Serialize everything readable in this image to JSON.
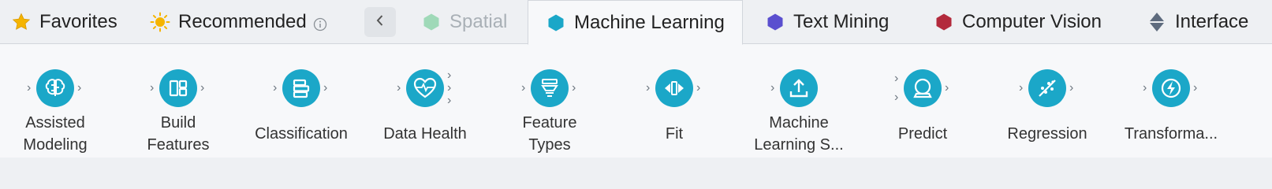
{
  "tabs": [
    {
      "label": "Favorites",
      "icon": "star-icon"
    },
    {
      "label": "Recommended",
      "icon": "sun-icon"
    },
    {
      "label": "Spatial",
      "icon": "hexagon-icon"
    },
    {
      "label": "Machine Learning",
      "icon": "hexagon-icon"
    },
    {
      "label": "Text Mining",
      "icon": "hexagon-icon"
    },
    {
      "label": "Computer Vision",
      "icon": "hexagon-icon"
    },
    {
      "label": "Interface",
      "icon": "diamond-icon"
    }
  ],
  "tools": [
    {
      "label": "Assisted\nModeling",
      "icon": "brain-icon"
    },
    {
      "label": "Build\nFeatures",
      "icon": "build-features-icon"
    },
    {
      "label": "Classification",
      "icon": "classification-icon"
    },
    {
      "label": "Data Health",
      "icon": "heart-pulse-icon"
    },
    {
      "label": "Feature\nTypes",
      "icon": "feature-types-icon"
    },
    {
      "label": "Fit",
      "icon": "fit-icon"
    },
    {
      "label": "Machine\nLearning S...",
      "icon": "upload-icon"
    },
    {
      "label": "Predict",
      "icon": "crystal-ball-icon"
    },
    {
      "label": "Regression",
      "icon": "regression-icon"
    },
    {
      "label": "Transforma...",
      "icon": "lightning-icon"
    }
  ],
  "colors": {
    "accent": "#1ba7c8",
    "spatial": "#9fd9b8",
    "text_mining": "#5a4fcf",
    "computer_vision": "#b32a3c",
    "favorites_star": "#f5b400",
    "recommended_sun": "#f5b400"
  }
}
